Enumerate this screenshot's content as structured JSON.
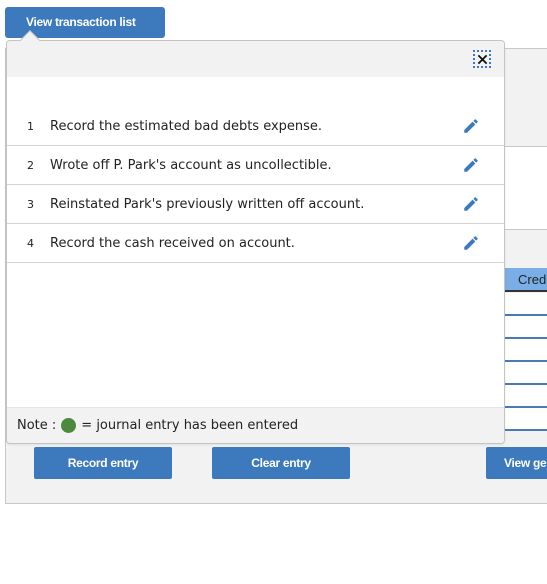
{
  "toolbar": {
    "view_transaction_list_label": "View transaction list"
  },
  "popup": {
    "close_icon": "close-icon",
    "transactions": [
      {
        "number": "1",
        "description": "Record the estimated bad debts expense.",
        "icon": "pencil-edit-icon"
      },
      {
        "number": "2",
        "description": "Wrote off P. Park's account as uncollectible.",
        "icon": "pencil-edit-icon"
      },
      {
        "number": "3",
        "description": "Reinstated Park's previously written off account.",
        "icon": "pencil-edit-icon"
      },
      {
        "number": "4",
        "description": "Record the cash received on account.",
        "icon": "pencil-edit-icon"
      }
    ],
    "note": {
      "prefix": "Note :",
      "suffix": "= journal entry has been entered",
      "dot_color": "#4b8a3e"
    }
  },
  "background": {
    "credit_column_header": "Cred",
    "view_general_journal_label": "View ge"
  },
  "actions": {
    "record_entry_label": "Record entry",
    "clear_entry_label": "Clear entry"
  },
  "colors": {
    "accent": "#3d7abd",
    "panel_bg": "#f2f2f2",
    "credit_header_bg": "#7aaee6"
  }
}
